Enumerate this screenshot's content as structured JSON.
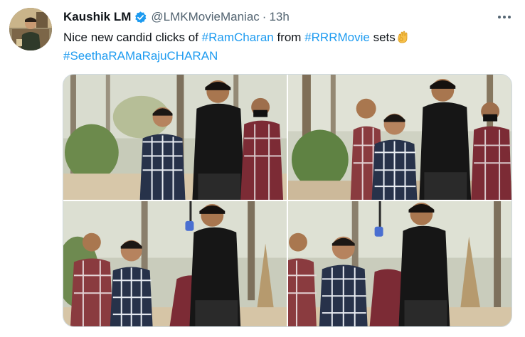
{
  "tweet": {
    "author_name": "Kaushik LM",
    "handle": "@LMKMovieManiac",
    "separator": "·",
    "time": "13h",
    "text_before": "Nice new candid clicks of ",
    "hashtag1": "#RamCharan",
    "text_mid": " from ",
    "hashtag2": "#RRRMovie",
    "text_after": " sets",
    "hashtag3": "#SeethaRAMaRajuCHARAN"
  },
  "colors": {
    "link": "#1d9bf0",
    "text": "#0f1419",
    "muted": "#536471",
    "verified": "#1d9bf0"
  },
  "icons": {
    "verified": "verified-badge-icon",
    "more": "more-options-icon",
    "emoji": "ok-hand-emoji-icon"
  },
  "photos_count": 4
}
